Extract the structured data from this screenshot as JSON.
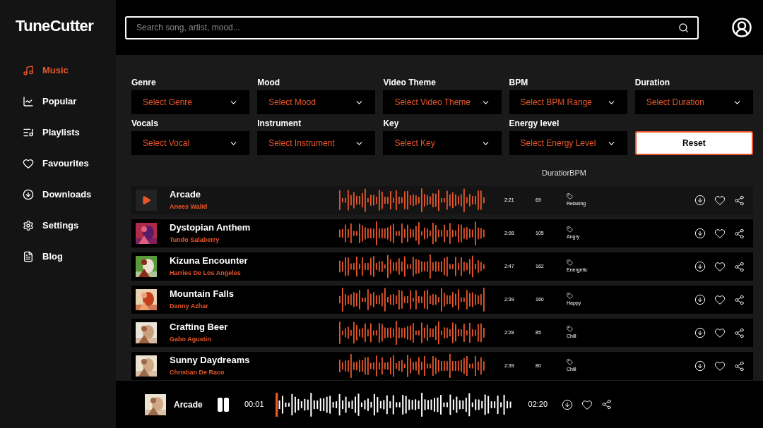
{
  "logo": "TuneCutter",
  "search": {
    "placeholder": "Search song, artist, mood..."
  },
  "sidebar": {
    "items": [
      {
        "label": "Music",
        "selected": true
      },
      {
        "label": "Popular",
        "selected": false
      },
      {
        "label": "Playlists",
        "selected": false
      },
      {
        "label": "Favourites",
        "selected": false
      },
      {
        "label": "Downloads",
        "selected": false
      },
      {
        "label": "Settings",
        "selected": false
      },
      {
        "label": "Blog",
        "selected": false
      }
    ]
  },
  "filters": [
    {
      "label": "Genre",
      "placeholder": "Select Genre"
    },
    {
      "label": "Mood",
      "placeholder": "Select Mood"
    },
    {
      "label": "Video Theme",
      "placeholder": "Select Video Theme"
    },
    {
      "label": "BPM",
      "placeholder": "Select BPM Range"
    },
    {
      "label": "Duration",
      "placeholder": "Select Duration"
    },
    {
      "label": "Vocals",
      "placeholder": "Select Vocal"
    },
    {
      "label": "Instrument",
      "placeholder": "Select Instrument"
    },
    {
      "label": "Key",
      "placeholder": "Select Key"
    },
    {
      "label": "Energy level",
      "placeholder": "Select Energy Level"
    }
  ],
  "reset_button": "Reset",
  "list_header": "DuratiorBPM",
  "tracks": [
    {
      "title": "Arcade",
      "artist": "Anees Walid",
      "duration": "2:21",
      "bpm": "69",
      "mood": "Relaxing",
      "selected": true
    },
    {
      "title": "Dystopian Anthem",
      "artist": "Tundo Salaberry",
      "duration": "2:08",
      "bpm": "105",
      "mood": "Angry",
      "selected": false
    },
    {
      "title": "Kizuna Encounter",
      "artist": "Harries De Los Angeles",
      "duration": "2:47",
      "bpm": "162",
      "mood": "Energetic",
      "selected": false
    },
    {
      "title": "Mountain Falls",
      "artist": "Danny Azhar",
      "duration": "2:39",
      "bpm": "160",
      "mood": "Happy",
      "selected": false
    },
    {
      "title": "Crafting Beer",
      "artist": "Gabo Agustin",
      "duration": "2:28",
      "bpm": "85",
      "mood": "Chill",
      "selected": false
    },
    {
      "title": "Sunny Daydreams",
      "artist": "Christian De Raco",
      "duration": "2:39",
      "bpm": "80",
      "mood": "Chill",
      "selected": false
    }
  ],
  "player": {
    "title": "Arcade",
    "elapsed": "00:01",
    "total": "02:20",
    "level": 0.01,
    "paused": false
  }
}
